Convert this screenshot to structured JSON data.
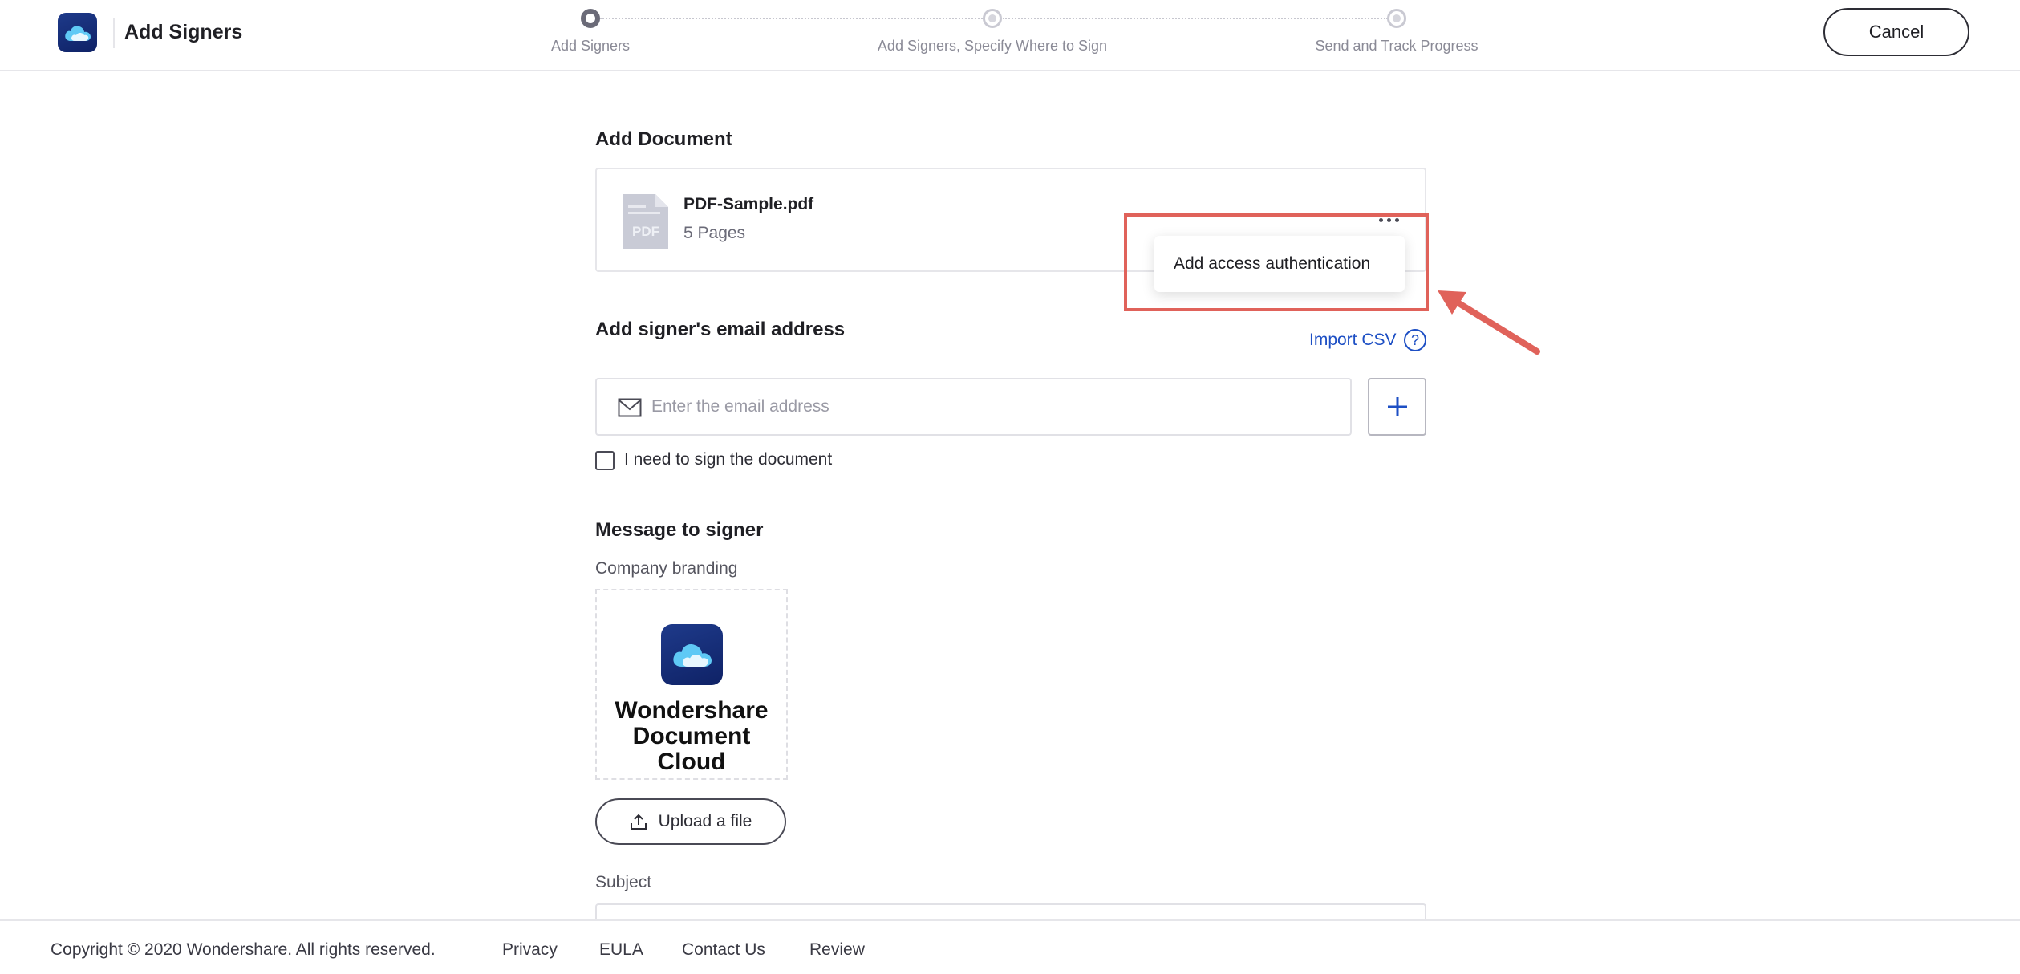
{
  "header": {
    "title": "Add Signers",
    "logo_icon": "cloud-icon",
    "cancel_label": "Cancel",
    "steps": [
      {
        "label": "Add Signers",
        "state": "active"
      },
      {
        "label": "Add Signers, Specify Where to Sign",
        "state": "inactive"
      },
      {
        "label": "Send and Track Progress",
        "state": "inactive"
      }
    ]
  },
  "document": {
    "section_title": "Add Document",
    "file_name": "PDF-Sample.pdf",
    "pages": "5 Pages",
    "file_icon_text": "PDF",
    "menu": {
      "items": [
        "Add access authentication"
      ]
    }
  },
  "signers": {
    "section_title": "Add signer's email address",
    "import_csv": "Import CSV",
    "help": "?",
    "email_placeholder": "Enter the email address",
    "self_sign_label": "I need to sign the document"
  },
  "message": {
    "section_title": "Message to signer",
    "branding_label": "Company branding",
    "brand_line1": "Wondershare",
    "brand_line2": "Document Cloud",
    "upload_label": "Upload a file",
    "subject_label": "Subject"
  },
  "footer": {
    "copyright": "Copyright © 2020 Wondershare. All rights reserved.",
    "links": [
      "Privacy",
      "EULA",
      "Contact Us",
      "Review"
    ]
  },
  "colors": {
    "accent": "#1d4fc4",
    "annotation": "#e0625a",
    "brand_dark": "#0f2266"
  }
}
